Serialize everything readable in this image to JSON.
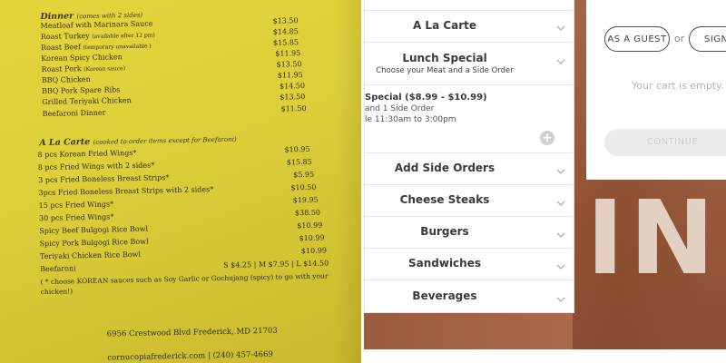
{
  "menu": {
    "dinner": {
      "title": "Dinner",
      "note": "(comes with 2 sides)",
      "items": [
        {
          "name": "Meatloaf with Marinara Sauce",
          "note": "",
          "price": "$13.50"
        },
        {
          "name": "Roast Turkey",
          "note": "(available after 12 pm)",
          "price": "$14.85"
        },
        {
          "name": "Roast Beef",
          "note": "(temporary unavailable )",
          "price": "$15.85"
        },
        {
          "name": "Korean Spicy Chicken",
          "note": "",
          "price": "$11.95"
        },
        {
          "name": "Roast Pork",
          "note": "(Korean sauce)",
          "price": "$13.50"
        },
        {
          "name": "BBQ Chicken",
          "note": "",
          "price": "$11.95"
        },
        {
          "name": "BBQ Pork Spare Ribs",
          "note": "",
          "price": "$14.50"
        },
        {
          "name": "Grilled Teriyaki Chicken",
          "note": "",
          "price": "$13.50"
        },
        {
          "name": "Beefaroni Dinner",
          "note": "",
          "price": "$11.50"
        }
      ]
    },
    "alacarte": {
      "title": "A La Carte",
      "note": "(cooked to order items except for Beefaroni)",
      "items": [
        {
          "name": "8 pcs Korean Fried Wings*",
          "price": "$10.95"
        },
        {
          "name": "8 pcs Fried Wings with 2 sides*",
          "price": "$15.85"
        },
        {
          "name": "3 pcs Fried Boneless Breast Strips*",
          "price": "$5.95"
        },
        {
          "name": "3pcs Fried Boneless Breast Strips with 2 sides*",
          "price": "$10.50"
        },
        {
          "name": "15 pcs Fried Wings*",
          "price": "$19.95"
        },
        {
          "name": "30 pcs Fried Wings*",
          "price": "$38.50"
        },
        {
          "name": "Spicy Beef Bulgogi Rice Bowl",
          "price": "$10.99"
        },
        {
          "name": "Spicy Pork Bulgogi Rice Bowl",
          "price": "$10.99"
        },
        {
          "name": "Teriyaki Chicken Rice Bowl",
          "price": "$10.99"
        },
        {
          "name": "Beefaroni",
          "price": "S $4.25 | M $7.95 | L $14.50"
        }
      ]
    },
    "footnote": "( * choose KOREAN sauces such as Soy Garlic or Gochujang (spicy) to go with your chicken!)",
    "address": "6956 Crestwood Blvd Frederick, MD 21703",
    "contact": "cornucopiafrederick.com | (240) 457-4669"
  },
  "accordion": {
    "items": [
      {
        "title": "A La Carte",
        "subtitle": ""
      },
      {
        "title": "Lunch Special",
        "subtitle": "Choose your Meat and a Side Order"
      },
      {
        "title": "Add Side Orders",
        "subtitle": ""
      },
      {
        "title": "Cheese Steaks",
        "subtitle": ""
      },
      {
        "title": "Burgers",
        "subtitle": ""
      },
      {
        "title": "Sandwiches",
        "subtitle": ""
      },
      {
        "title": "Beverages",
        "subtitle": ""
      }
    ],
    "expanded_item": {
      "name": "Special ($8.99 - $10.99)",
      "line1": "and 1 Side Order",
      "line2": "le 11:30am to 3:00pm",
      "add_icon": "plus-circle-icon"
    },
    "chevron_icon": "chevron-down-icon"
  },
  "cart": {
    "guest_label": "AS A GUEST",
    "or_label": "or",
    "signin_label": "SIGN",
    "empty_text": "Your cart is empty.",
    "continue_label": "CONTINUE"
  },
  "background": {
    "letters": "IN"
  },
  "colors": {
    "menu_paper": "#ddd03a",
    "photo_brick": "#9a5a3c",
    "continue_disabled": "#ececec"
  }
}
